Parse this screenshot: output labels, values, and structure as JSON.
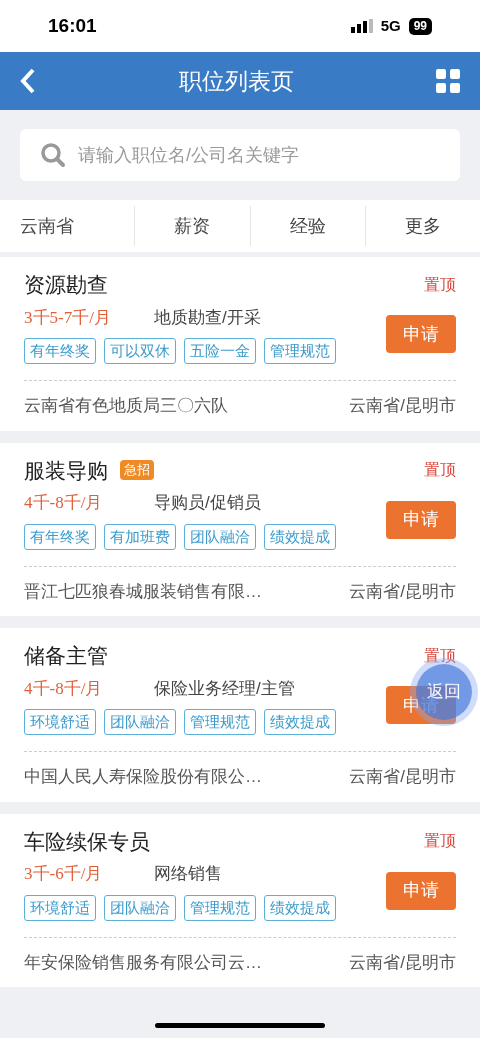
{
  "status_bar": {
    "time": "16:01",
    "network": "5G",
    "battery": "99"
  },
  "header": {
    "title": "职位列表页"
  },
  "search": {
    "placeholder": "请输入职位名/公司名关键字"
  },
  "filters": [
    "云南省",
    "薪资",
    "经验",
    "更多"
  ],
  "jobs": [
    {
      "title": "资源勘查",
      "pin": "置顶",
      "salary": "3千5-7千/月",
      "category": "地质勘查/开采",
      "tags": [
        "有年终奖",
        "可以双休",
        "五险一金",
        "管理规范"
      ],
      "apply": "申请",
      "company": "云南省有色地质局三〇六队",
      "location": "云南省/昆明市"
    },
    {
      "title": "服装导购",
      "badge": "急招",
      "pin": "置顶",
      "salary": "4千-8千/月",
      "category": "导购员/促销员",
      "tags": [
        "有年终奖",
        "有加班费",
        "团队融洽",
        "绩效提成"
      ],
      "apply": "申请",
      "company": "晋江七匹狼春城服装销售有限…",
      "location": "云南省/昆明市"
    },
    {
      "title": "储备主管",
      "pin": "置顶",
      "salary": "4千-8千/月",
      "category": "保险业务经理/主管",
      "tags": [
        "环境舒适",
        "团队融洽",
        "管理规范",
        "绩效提成"
      ],
      "apply": "申请",
      "company": "中国人民人寿保险股份有限公…",
      "location": "云南省/昆明市"
    },
    {
      "title": "车险续保专员",
      "pin": "置顶",
      "salary": "3千-6千/月",
      "category": "网络销售",
      "tags": [
        "环境舒适",
        "团队融洽",
        "管理规范",
        "绩效提成"
      ],
      "apply": "申请",
      "company": "年安保险销售服务有限公司云…",
      "location": "云南省/昆明市"
    }
  ],
  "float_button": {
    "label": "返回"
  }
}
